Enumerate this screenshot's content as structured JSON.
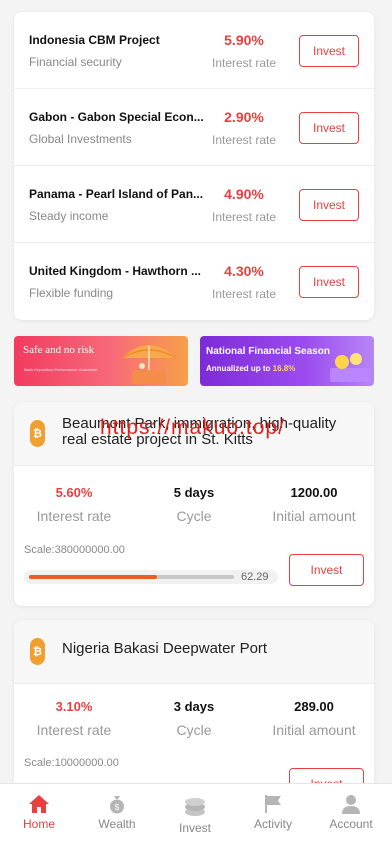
{
  "projects_list": [
    {
      "name": "Indonesia CBM Project",
      "category": "Financial security",
      "rate": "5.90%",
      "rate_label": "Interest rate",
      "button": "Invest"
    },
    {
      "name": "Gabon - Gabon Special Econ...",
      "category": "Global Investments",
      "rate": "2.90%",
      "rate_label": "Interest rate",
      "button": "Invest"
    },
    {
      "name": "Panama - Pearl Island of Pan...",
      "category": "Steady income",
      "rate": "4.90%",
      "rate_label": "Interest rate",
      "button": "Invest"
    },
    {
      "name": "United Kingdom - Hawthorn ...",
      "category": "Flexible funding",
      "rate": "4.30%",
      "rate_label": "Interest rate",
      "button": "Invest"
    }
  ],
  "banners": {
    "left": {
      "headline": "Safe and no risk",
      "caption": "Bank Depository Performance Guarantee"
    },
    "right": {
      "headline": "National Financial Season",
      "caption_prefix": "Annualized up to ",
      "caption_value": "16.8%"
    }
  },
  "featured": [
    {
      "coin_symbol": "₿",
      "title": "Beaumont Park, immigration, high-quality real estate project in St. Kitts",
      "rate": "5.60%",
      "rate_label": "Interest rate",
      "cycle": "5 days",
      "cycle_label": "Cycle",
      "amount": "1200.00",
      "amount_label": "Initial amount",
      "scale": "Scale:380000000.00",
      "progress": 62.29,
      "progress_text": "62.29",
      "button": "Invest"
    },
    {
      "coin_symbol": "₿",
      "title": "Nigeria Bakasi Deepwater Port",
      "rate": "3.10%",
      "rate_label": "Interest rate",
      "cycle": "3 days",
      "cycle_label": "Cycle",
      "amount": "289.00",
      "amount_label": "Initial amount",
      "scale": "Scale:10000000.00",
      "button": "Invest"
    }
  ],
  "watermark": "https://makuo.top/",
  "tabbar": [
    {
      "label": "Home",
      "icon": "home-icon",
      "active": true
    },
    {
      "label": "Wealth",
      "icon": "money-bag-icon",
      "active": false
    },
    {
      "label": "Invest",
      "icon": "coins-icon",
      "active": false
    },
    {
      "label": "Activity",
      "icon": "flag-icon",
      "active": false
    },
    {
      "label": "Account",
      "icon": "user-icon",
      "active": false
    }
  ],
  "colors": {
    "accent": "#e84040",
    "progress": "#ef5a2a",
    "coin": "#f0a030"
  }
}
